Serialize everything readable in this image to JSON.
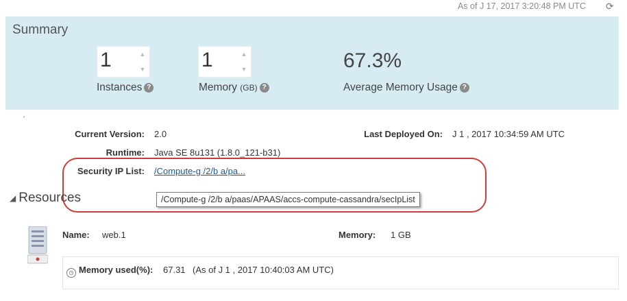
{
  "header": {
    "as_of": "As of J  17, 2017 3:20:48 PM UTC",
    "refresh_icon": "refresh-icon"
  },
  "summary": {
    "title": "Summary",
    "instances": {
      "value": "1",
      "label": "Instances"
    },
    "memory": {
      "value": "1",
      "label": "Memory",
      "unit": "(GB)"
    },
    "avg_memory": {
      "value": "67.3%",
      "label": "Average Memory Usage"
    }
  },
  "details": {
    "current_version_label": "Current Version:",
    "current_version": "2.0",
    "last_deployed_label": "Last Deployed On:",
    "last_deployed": "J  1 ,  2017  10:34:59 AM UTC",
    "runtime_label": "Runtime:",
    "runtime": "Java SE 8u131 (1.8.0_121-b31)",
    "security_ip_label": "Security IP List:",
    "security_ip_link": "/Compute-g          /2/b        a/pa...",
    "tooltip": "/Compute-g         /2/b       a/paas/APAAS/accs-compute-cassandra/secIpList"
  },
  "resources": {
    "title": "Resources",
    "name_label": "Name:",
    "name": "web.1",
    "memory_label": "Memory:",
    "memory": "1 GB",
    "memory_used_label": "Memory used(%):",
    "memory_used": "67.31",
    "memory_used_asof": "(As of J  1 ,  2017 10:40:03 AM UTC)"
  },
  "colors": {
    "summary_bg": "#d6ecf2",
    "highlight": "#d13a3a",
    "link": "#1a5a9a"
  }
}
